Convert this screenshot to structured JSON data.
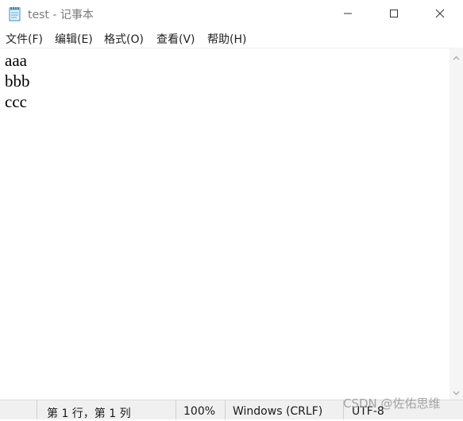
{
  "window": {
    "title": "test - 记事本",
    "app_icon": "notepad-icon"
  },
  "controls": {
    "minimize_icon": "minimize-icon",
    "maximize_icon": "maximize-icon",
    "close_icon": "close-icon"
  },
  "menu": {
    "items": [
      {
        "label": "文件(F)"
      },
      {
        "label": "编辑(E)"
      },
      {
        "label": "格式(O)"
      },
      {
        "label": "查看(V)"
      },
      {
        "label": "帮助(H)"
      }
    ]
  },
  "editor": {
    "lines": [
      "aaa",
      "bbb",
      "ccc"
    ]
  },
  "statusbar": {
    "position": "第 1 行，第 1 列",
    "zoom": "100%",
    "line_ending": "Windows (CRLF)",
    "encoding": "UTF-8"
  },
  "watermark": "CSDN @佐佑思维",
  "colors": {
    "title_text": "#7a7a7a",
    "statusbar_bg": "#f0f0f0",
    "editor_bg": "#ffffff"
  }
}
